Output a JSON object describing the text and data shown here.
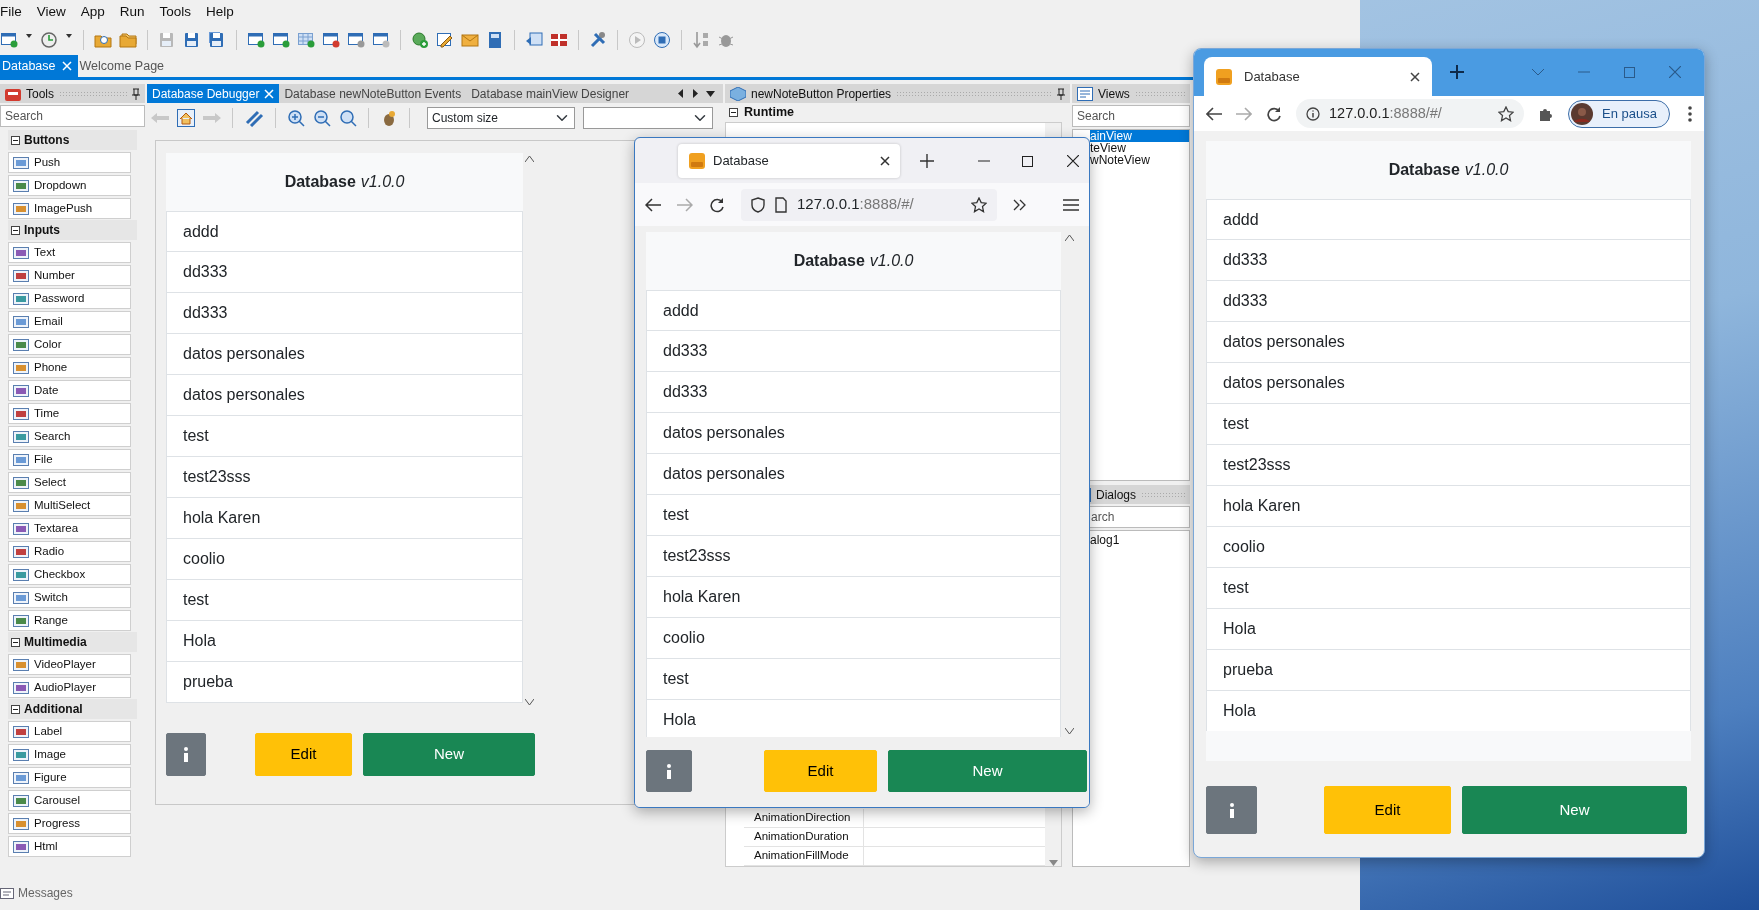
{
  "ide": {
    "menu": [
      "File",
      "View",
      "App",
      "Run",
      "Tools",
      "Help"
    ],
    "doc_tabs": [
      {
        "label": "Database",
        "selected": true
      },
      {
        "label": "Welcome Page",
        "selected": false
      }
    ],
    "tools_panel": {
      "title": "Tools",
      "search_placeholder": "Search",
      "groups": [
        {
          "label": "Buttons",
          "expanded": true,
          "items": [
            "Push",
            "Dropdown",
            "ImagePush"
          ]
        },
        {
          "label": "Inputs",
          "expanded": true,
          "items": [
            "Text",
            "Number",
            "Password",
            "Email",
            "Color",
            "Phone",
            "Date",
            "Time",
            "Search",
            "File",
            "Select",
            "MultiSelect",
            "Textarea",
            "Radio",
            "Checkbox",
            "Switch",
            "Range"
          ]
        },
        {
          "label": "Multimedia",
          "expanded": true,
          "items": [
            "VideoPlayer",
            "AudioPlayer"
          ]
        },
        {
          "label": "Additional",
          "expanded": true,
          "items": [
            "Label",
            "Image",
            "Figure",
            "Carousel",
            "Progress",
            "Html"
          ]
        }
      ]
    },
    "debugger": {
      "tabs": [
        {
          "label": "Database Debugger",
          "selected": true
        },
        {
          "label": "Database newNoteButton Events",
          "selected": false
        },
        {
          "label": "Database mainView Designer",
          "selected": false
        }
      ],
      "size_select": "Custom size",
      "app": {
        "title": "Database",
        "version": "v1.0.0",
        "items": [
          "addd",
          "dd333",
          "dd333",
          "datos personales",
          "datos personales",
          "test",
          "test23sss",
          "hola Karen",
          "coolio",
          "test",
          "Hola",
          "prueba"
        ],
        "buttons": [
          {
            "kind": "info"
          },
          {
            "kind": "edit",
            "label": "Edit"
          },
          {
            "kind": "new",
            "label": "New"
          }
        ]
      }
    },
    "properties": {
      "title": "newNoteButton Properties",
      "section": "Runtime",
      "section_expanded": true,
      "rows": [
        "AnimationDirection",
        "AnimationDuration",
        "AnimationFillMode"
      ]
    },
    "views": {
      "title": "Views",
      "search_placeholder": "Search",
      "items": [
        {
          "label": "ainView",
          "selected": true
        },
        {
          "label": "teView",
          "selected": false
        },
        {
          "label": "wNoteView",
          "selected": false
        }
      ]
    },
    "dialogs": {
      "title": "Dialogs",
      "search_placeholder": "arch",
      "items": [
        "alog1"
      ]
    },
    "bottom_tab": "Messages"
  },
  "firefox": {
    "tab": "Database",
    "url_host": "127.0.0.1",
    "url_rest": ":8888/#/",
    "app": {
      "title": "Database",
      "version": "v1.0.0",
      "items": [
        "addd",
        "dd333",
        "dd333",
        "datos personales",
        "datos personales",
        "test",
        "test23sss",
        "hola Karen",
        "coolio",
        "test",
        "Hola"
      ],
      "buttons": [
        {
          "kind": "info"
        },
        {
          "kind": "edit",
          "label": "Edit"
        },
        {
          "kind": "new",
          "label": "New"
        }
      ]
    }
  },
  "chrome": {
    "tab": "Database",
    "url_host": "127.0.0.1",
    "url_rest": ":8888/#/",
    "profile": "En pausa",
    "app": {
      "title": "Database",
      "version": "v1.0.0",
      "items": [
        "addd",
        "dd333",
        "dd333",
        "datos personales",
        "datos personales",
        "test",
        "test23sss",
        "hola Karen",
        "coolio",
        "test",
        "Hola",
        "prueba",
        "Hola"
      ],
      "buttons": [
        {
          "kind": "info"
        },
        {
          "kind": "edit",
          "label": "Edit"
        },
        {
          "kind": "new",
          "label": "New"
        }
      ]
    }
  }
}
